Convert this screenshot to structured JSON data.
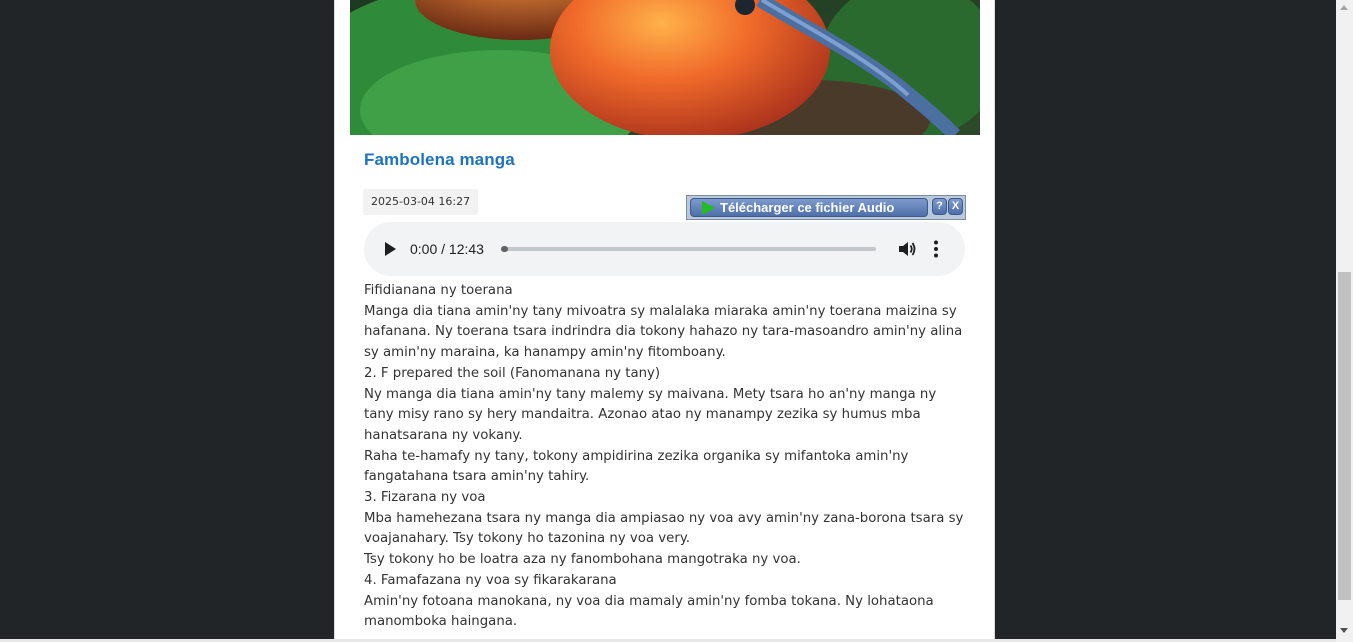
{
  "article": {
    "title": "Fambolena manga",
    "date": "2025-03-04 16:27"
  },
  "download_bar": {
    "label": "Télécharger ce fichier Audio",
    "help": "?",
    "close": "X",
    "play_icon": "play-icon",
    "accent": "#22bb22"
  },
  "audio_player": {
    "time": "0:00 / 12:43",
    "progress": 0,
    "icons": [
      "play-icon",
      "volume-icon",
      "more-vertical-icon"
    ]
  },
  "content": {
    "paragraphs": [
      "Fifidianana ny toerana",
      "Manga dia tiana amin'ny tany mivoatra sy malalaka miaraka amin'ny toerana maizina sy hafanana. Ny toerana tsara indrindra dia tokony hahazo ny tara-masoandro amin'ny alina sy amin'ny maraina, ka hanampy amin'ny fitomboany.",
      "2. F prepared the soil (Fanomanana ny tany)",
      "Ny manga dia tiana amin'ny tany malemy sy maivana. Mety tsara ho an'ny manga ny tany misy rano sy hery mandaitra. Azonao atao ny manampy zezika sy humus mba hanatsarana ny vokany.",
      "Raha te-hamafy ny tany, tokony ampidirina zezika organika sy mifantoka amin'ny fangatahana tsara amin'ny tahiry.",
      "3. Fizarana ny voa",
      "Mba hamehezana tsara ny manga dia ampiasao ny voa avy amin'ny zana-borona tsara sy voajanahary. Tsy tokony ho tazonina ny voa very.",
      "Tsy tokony ho be loatra aza ny fanombohana mangotraka ny voa.",
      "4. Famafazana ny voa sy fikarakarana",
      "Amin'ny fotoana manokana, ny voa dia mamaly amin'ny fomba tokana. Ny lohataona manomboka haingana."
    ]
  },
  "colors": {
    "page_background": "#212528",
    "title": "#1e73be"
  }
}
